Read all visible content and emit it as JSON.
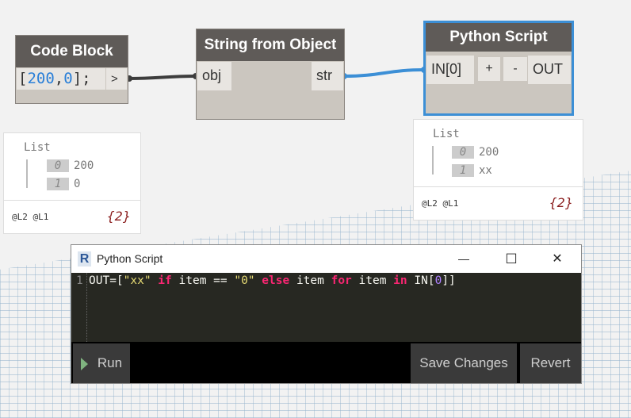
{
  "code_block": {
    "title": "Code Block",
    "code_open": "[",
    "code_n1": "200",
    "code_comma": ",",
    "code_n2": "0",
    "code_close": "];",
    "out_port": ">",
    "preview": {
      "header": "List",
      "items": [
        {
          "index": "0",
          "value": "200"
        },
        {
          "index": "1",
          "value": "0"
        }
      ],
      "levels": "@L2 @L1",
      "count": "{2}"
    }
  },
  "string_from_object": {
    "title": "String from Object",
    "in_port": "obj",
    "out_port": "str"
  },
  "python_node": {
    "title": "Python Script",
    "in_port": "IN[0]",
    "add": "+",
    "remove": "-",
    "out_port": "OUT",
    "preview": {
      "header": "List",
      "items": [
        {
          "index": "0",
          "value": "200"
        },
        {
          "index": "1",
          "value": "xx"
        }
      ],
      "levels": "@L2 @L1",
      "count": "{2}"
    }
  },
  "dialog": {
    "icon": "R",
    "title": "Python Script",
    "line_number": "1",
    "code": [
      {
        "t": "OUT=[",
        "c": "#f8f8f2"
      },
      {
        "t": "\"xx\"",
        "c": "#e6db74"
      },
      {
        "t": " if ",
        "c": "#f92672"
      },
      {
        "t": "item == ",
        "c": "#f8f8f2"
      },
      {
        "t": "\"0\"",
        "c": "#e6db74"
      },
      {
        "t": " else ",
        "c": "#f92672"
      },
      {
        "t": "item ",
        "c": "#f8f8f2"
      },
      {
        "t": "for ",
        "c": "#f92672"
      },
      {
        "t": "item ",
        "c": "#f8f8f2"
      },
      {
        "t": "in ",
        "c": "#f92672"
      },
      {
        "t": "IN[",
        "c": "#f8f8f2"
      },
      {
        "t": "0",
        "c": "#ae81ff"
      },
      {
        "t": "]]",
        "c": "#f8f8f2"
      }
    ],
    "run": "Run",
    "save": "Save Changes",
    "revert": "Revert",
    "minimize": "—",
    "maximize": "☐",
    "close": "✕"
  },
  "colors": {
    "selected_border": "#3c8fd6",
    "wire_active": "#3c8fd6",
    "wire": "#3d3d3d"
  }
}
